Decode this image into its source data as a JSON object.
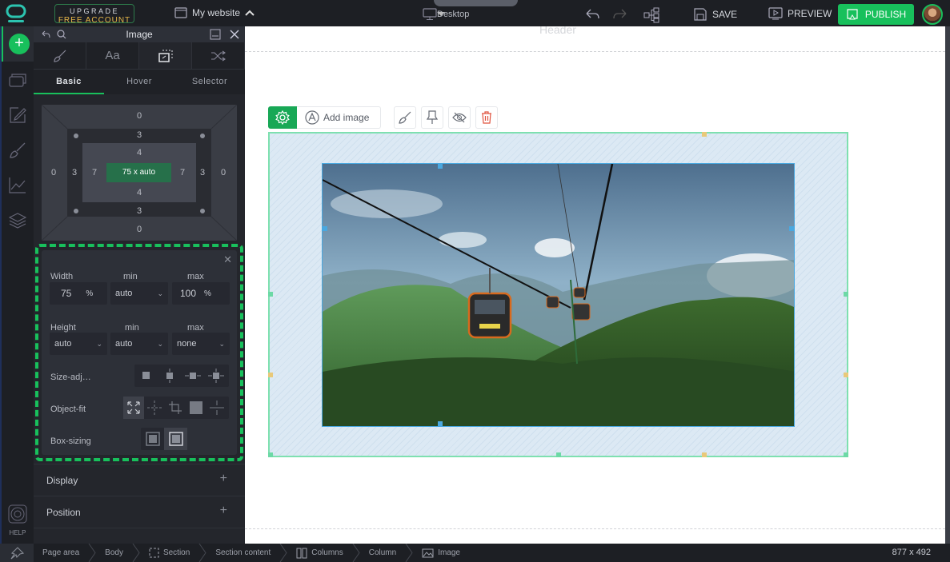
{
  "topbar": {
    "upgrade_line1": "UPGRADE",
    "upgrade_line2": "FREE ACCOUNT",
    "site_name": "My website",
    "device": "Desktop",
    "save_label": "SAVE",
    "preview_label": "PREVIEW",
    "publish_label": "PUBLISH"
  },
  "rail": {
    "items": [
      "add",
      "pages",
      "edit",
      "design",
      "analytics",
      "layers"
    ],
    "help_label": "HELP"
  },
  "panel": {
    "title": "Image",
    "icon_tabs": [
      "brush",
      "typography",
      "size",
      "interactions"
    ],
    "text_tabs": [
      "Basic",
      "Hover",
      "Selector"
    ],
    "active_text_tab": "Basic",
    "box_model": {
      "margin": {
        "top": "0",
        "right": "0",
        "bottom": "0",
        "left": "0"
      },
      "border": {
        "top": "3",
        "right": "3",
        "bottom": "3",
        "left": "3"
      },
      "padding": {
        "top": "4",
        "right": "7",
        "bottom": "4",
        "left": "7"
      },
      "content": "75 x auto"
    },
    "size": {
      "width_label": "Width",
      "min_label": "min",
      "max_label": "max",
      "width_value": "75",
      "width_unit": "%",
      "width_min": "auto",
      "width_max": "100",
      "width_max_unit": "%",
      "height_label": "Height",
      "height_value": "auto",
      "height_min": "auto",
      "height_max": "none",
      "size_adjust_label": "Size-adj…",
      "object_fit_label": "Object-fit",
      "box_sizing_label": "Box-sizing"
    },
    "sections": [
      "Display",
      "Position"
    ]
  },
  "canvas": {
    "header_label": "Header",
    "add_image_label": "Add image"
  },
  "status": {
    "breadcrumbs": [
      "Page area",
      "Body",
      "Section",
      "Section content",
      "Columns",
      "Column",
      "Image"
    ],
    "dimensions": "877 x 492"
  },
  "colors": {
    "accent": "#18c05c",
    "delete": "#e0533f"
  }
}
